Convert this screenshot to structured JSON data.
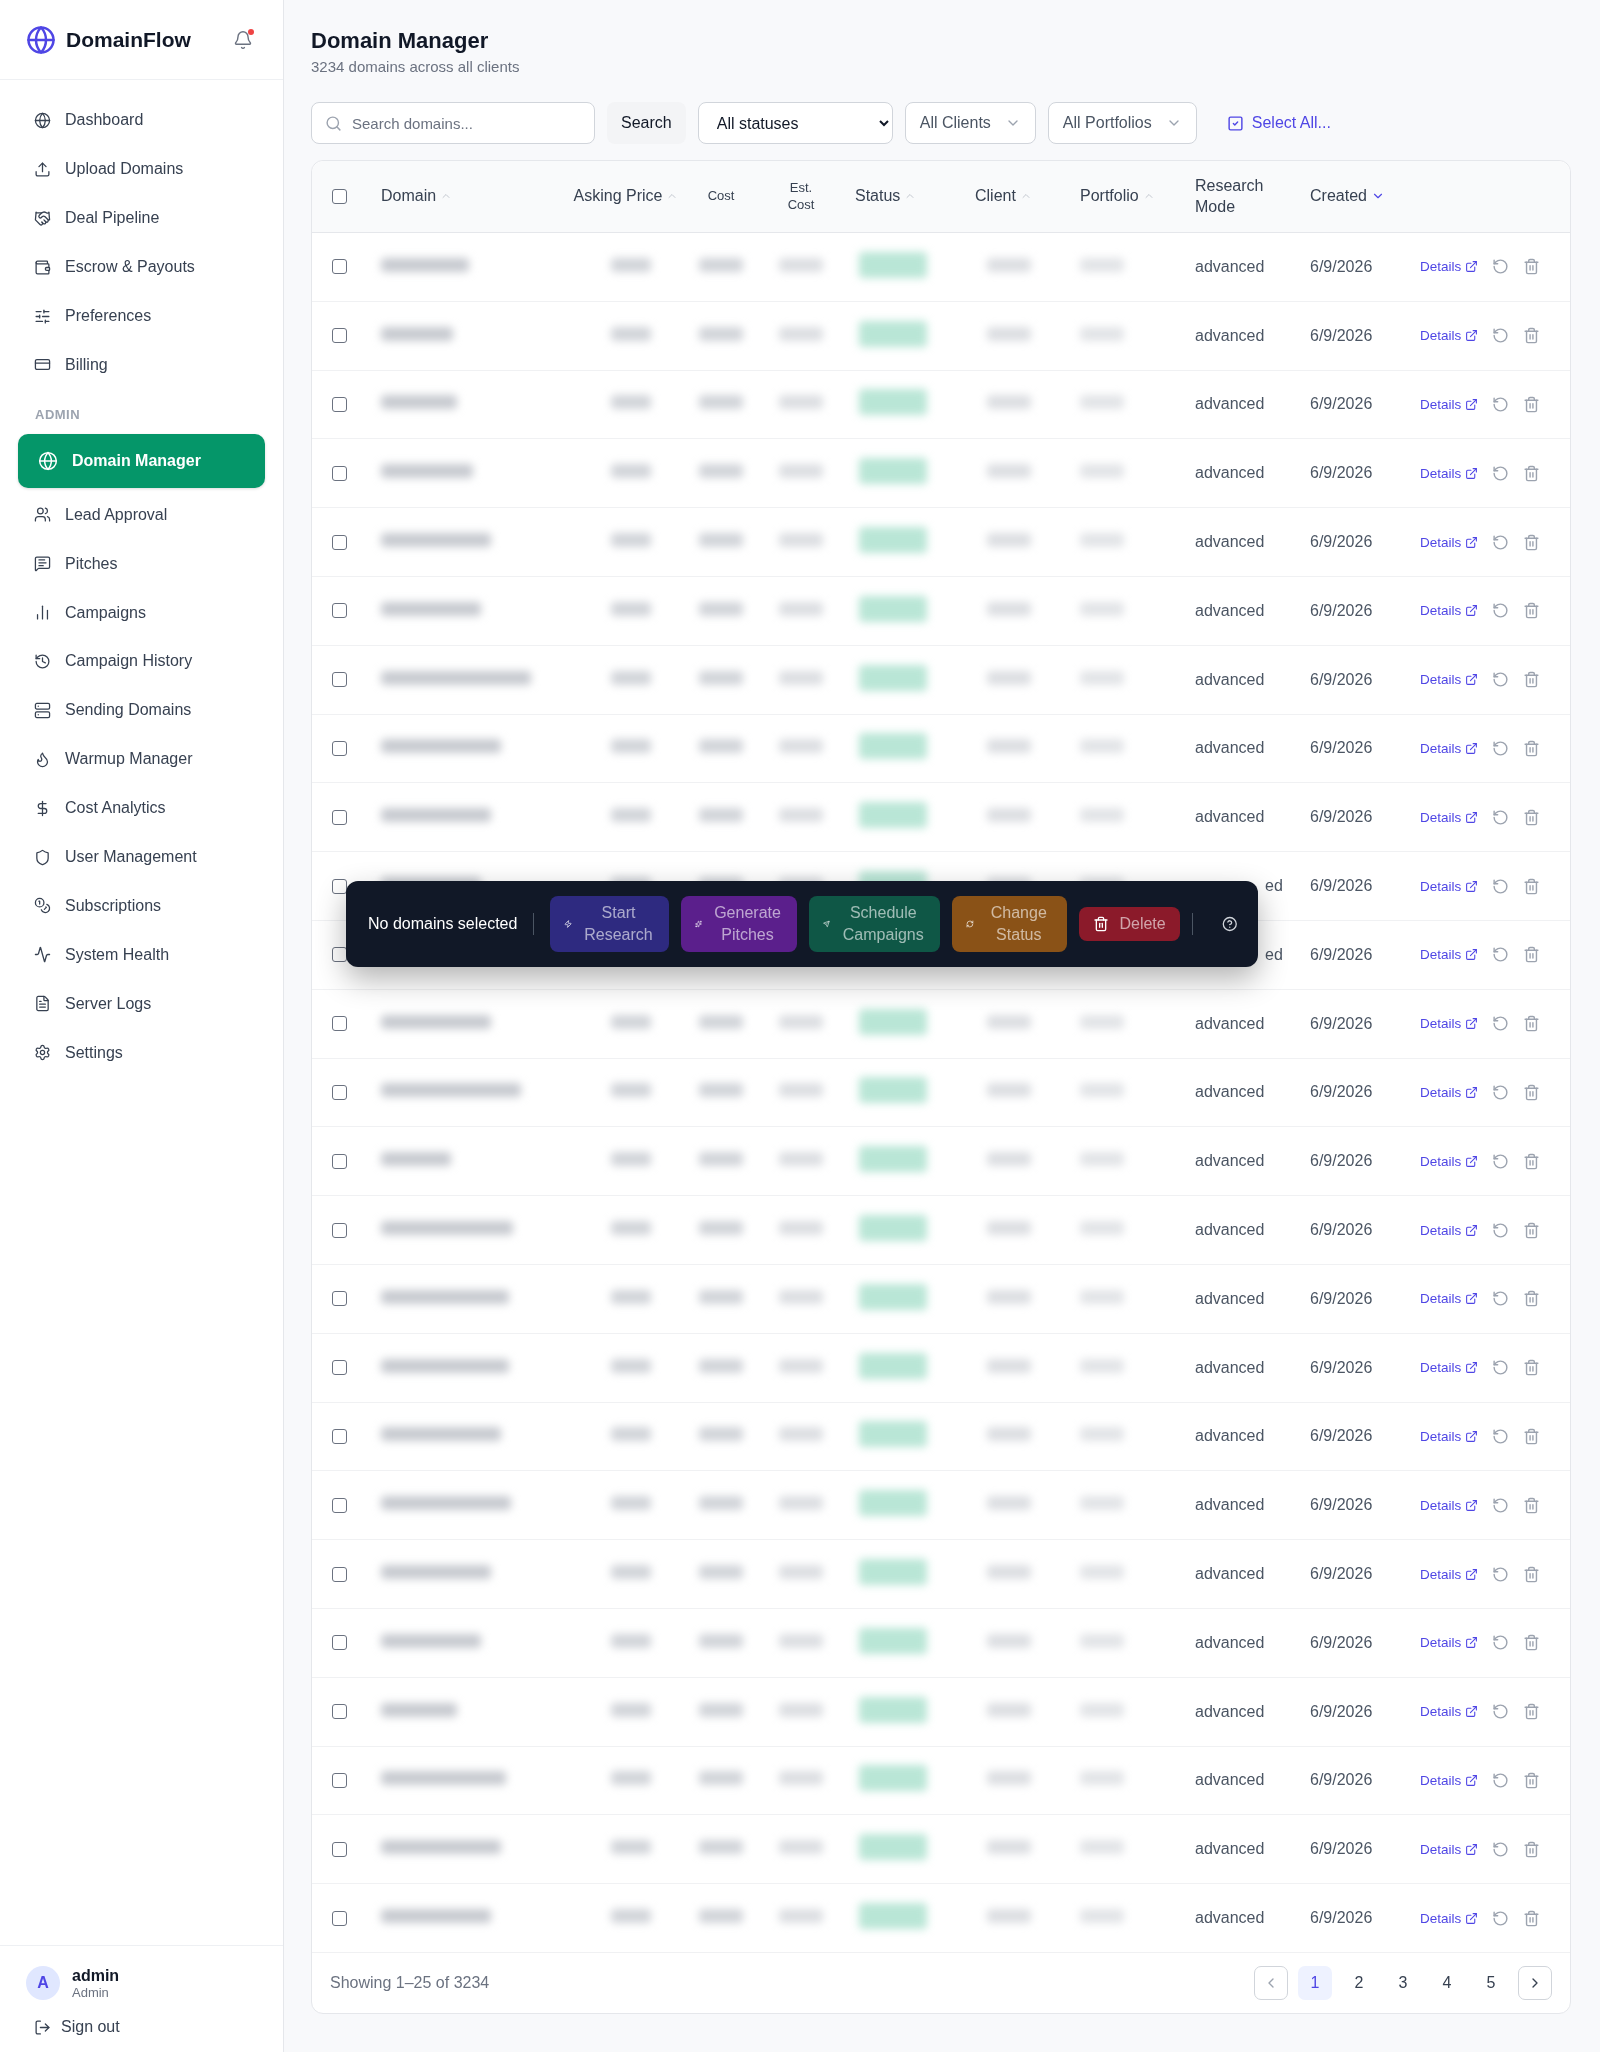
{
  "brand": {
    "name": "DomainFlow",
    "has_notification": true
  },
  "nav": [
    {
      "label": "Dashboard",
      "selected": false
    },
    {
      "label": "Upload Domains",
      "selected": false
    },
    {
      "label": "Deal Pipeline",
      "selected": false
    },
    {
      "label": "Escrow & Payouts",
      "selected": false
    },
    {
      "label": "Preferences",
      "selected": false
    },
    {
      "label": "Billing",
      "selected": false
    }
  ],
  "admin_section": {
    "heading": "ADMIN",
    "items": [
      {
        "label": "Domain Manager",
        "selected": true
      },
      {
        "label": "Lead Approval",
        "selected": false
      },
      {
        "label": "Pitches",
        "selected": false
      },
      {
        "label": "Campaigns",
        "selected": false
      },
      {
        "label": "Campaign History",
        "selected": false
      },
      {
        "label": "Sending Domains",
        "selected": false
      },
      {
        "label": "Warmup Manager",
        "selected": false
      },
      {
        "label": "Cost Analytics",
        "selected": false
      },
      {
        "label": "User Management",
        "selected": false
      },
      {
        "label": "Subscriptions",
        "selected": false
      },
      {
        "label": "System Health",
        "selected": false
      },
      {
        "label": "Server Logs",
        "selected": false
      },
      {
        "label": "Settings",
        "selected": false
      }
    ]
  },
  "user": {
    "initial": "A",
    "name": "admin",
    "role": "Admin",
    "sign_out": "Sign out"
  },
  "page": {
    "title": "Domain Manager",
    "subtitle": "3234 domains across all clients"
  },
  "filters": {
    "search": {
      "placeholder": "Search domains..."
    },
    "search_button": "Search",
    "status_select": "All statuses",
    "clients": "All Clients",
    "portfolios": "All Portfolios",
    "select_all": "Select All..."
  },
  "table": {
    "select_all_checked": false,
    "columns": [
      {
        "label": "Domain",
        "sortable": true,
        "sorted": false
      },
      {
        "label": "Asking Price",
        "sortable": true,
        "sorted": false
      },
      {
        "label": "Cost",
        "sortable": false
      },
      {
        "label": "Est. Cost",
        "sortable": false
      },
      {
        "label": "Status",
        "sortable": true,
        "sorted": false
      },
      {
        "label": "Client",
        "sortable": true,
        "sorted": false
      },
      {
        "label": "Portfolio",
        "sortable": true,
        "sorted": false
      },
      {
        "label": "Research Mode",
        "sortable": false
      },
      {
        "label": "Created",
        "sortable": true,
        "sorted": true
      }
    ],
    "rows": [
      {
        "kind": "normal",
        "checked": false,
        "research_mode": "advanced",
        "created": "6/9/2026",
        "details": "Details"
      },
      {
        "kind": "normal",
        "checked": false,
        "research_mode": "advanced",
        "created": "6/9/2026",
        "details": "Details"
      },
      {
        "kind": "normal",
        "checked": false,
        "research_mode": "advanced",
        "created": "6/9/2026",
        "details": "Details"
      },
      {
        "kind": "normal",
        "checked": false,
        "research_mode": "advanced",
        "created": "6/9/2026",
        "details": "Details"
      },
      {
        "kind": "normal",
        "checked": false,
        "research_mode": "advanced",
        "created": "6/9/2026",
        "details": "Details"
      },
      {
        "kind": "normal",
        "checked": false,
        "research_mode": "advanced",
        "created": "6/9/2026",
        "details": "Details"
      },
      {
        "kind": "normal",
        "checked": false,
        "research_mode": "advanced",
        "created": "6/9/2026",
        "details": "Details"
      },
      {
        "kind": "normal",
        "checked": false,
        "research_mode": "advanced",
        "created": "6/9/2026",
        "details": "Details"
      },
      {
        "kind": "normal",
        "checked": false,
        "research_mode": "advanced",
        "created": "6/9/2026",
        "details": "Details"
      },
      {
        "kind": "partly_covered",
        "checked": false,
        "research_mode": "ed",
        "created": "6/9/2026",
        "details": "Details"
      },
      {
        "kind": "covered",
        "checked": false,
        "research_mode": "ed",
        "created": "6/9/2026",
        "details": "Details"
      },
      {
        "kind": "normal",
        "checked": false,
        "research_mode": "advanced",
        "created": "6/9/2026",
        "details": "Details"
      },
      {
        "kind": "normal",
        "checked": false,
        "research_mode": "advanced",
        "created": "6/9/2026",
        "details": "Details"
      },
      {
        "kind": "normal",
        "checked": false,
        "research_mode": "advanced",
        "created": "6/9/2026",
        "details": "Details"
      },
      {
        "kind": "normal",
        "checked": false,
        "research_mode": "advanced",
        "created": "6/9/2026",
        "details": "Details"
      },
      {
        "kind": "normal",
        "checked": false,
        "research_mode": "advanced",
        "created": "6/9/2026",
        "details": "Details"
      },
      {
        "kind": "normal",
        "checked": false,
        "research_mode": "advanced",
        "created": "6/9/2026",
        "details": "Details"
      },
      {
        "kind": "normal",
        "checked": false,
        "research_mode": "advanced",
        "created": "6/9/2026",
        "details": "Details"
      },
      {
        "kind": "normal",
        "checked": false,
        "research_mode": "advanced",
        "created": "6/9/2026",
        "details": "Details"
      },
      {
        "kind": "normal",
        "checked": false,
        "research_mode": "advanced",
        "created": "6/9/2026",
        "details": "Details"
      },
      {
        "kind": "normal",
        "checked": false,
        "research_mode": "advanced",
        "created": "6/9/2026",
        "details": "Details"
      },
      {
        "kind": "normal",
        "checked": false,
        "research_mode": "advanced",
        "created": "6/9/2026",
        "details": "Details"
      },
      {
        "kind": "normal",
        "checked": false,
        "research_mode": "advanced",
        "created": "6/9/2026",
        "details": "Details"
      },
      {
        "kind": "normal",
        "checked": false,
        "research_mode": "advanced",
        "created": "6/9/2026",
        "details": "Details"
      },
      {
        "kind": "normal",
        "checked": false,
        "research_mode": "advanced",
        "created": "6/9/2026",
        "details": "Details"
      }
    ]
  },
  "bulk_bar": {
    "status": "No domains selected",
    "actions": [
      {
        "label": "Start Research",
        "color": "#2e2a80",
        "disabled": true
      },
      {
        "label": "Generate Pitches",
        "color": "#5b1f8c",
        "disabled": true
      },
      {
        "label": "Schedule Campaigns",
        "color": "#0f5746",
        "disabled": true
      },
      {
        "label": "Change Status",
        "color": "#8a5217",
        "disabled": true
      },
      {
        "label": "Delete",
        "color": "#8b1a2a",
        "disabled": true
      }
    ]
  },
  "pagination": {
    "summary": "Showing 1–25 of 3234",
    "pages": [
      {
        "label": "1",
        "selected": true
      },
      {
        "label": "2",
        "selected": false
      },
      {
        "label": "3",
        "selected": false
      },
      {
        "label": "4",
        "selected": false
      },
      {
        "label": "5",
        "selected": false
      }
    ],
    "prev_disabled": true,
    "next_disabled": false
  }
}
